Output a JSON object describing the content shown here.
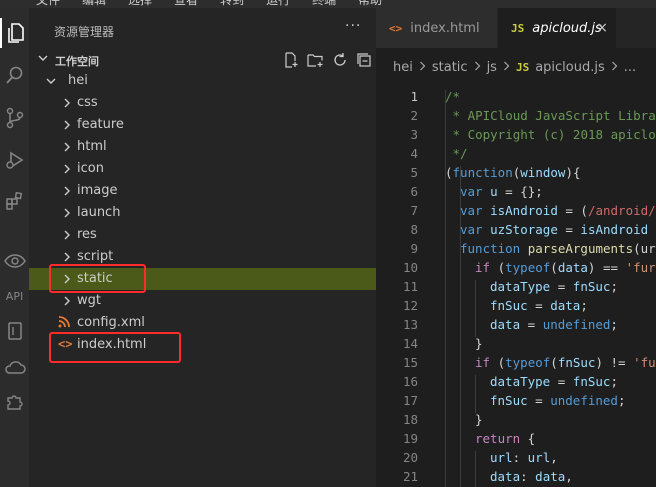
{
  "menu_bar": [
    "文件",
    "编辑",
    "选择",
    "查看",
    "转到",
    "运行",
    "终端",
    "帮助"
  ],
  "activity_bar": {
    "api_label": "API"
  },
  "explorer": {
    "title": "资源管理器",
    "more": "···",
    "workspace": "工作空间",
    "root": "hei",
    "folders": [
      "css",
      "feature",
      "html",
      "icon",
      "image",
      "launch",
      "res",
      "script",
      "static",
      "wgt"
    ],
    "selected_folder": "static",
    "files": [
      {
        "name": "config.xml",
        "icon": "rss-icon"
      },
      {
        "name": "index.html",
        "icon": "html-icon"
      }
    ]
  },
  "tabs": [
    {
      "label": "index.html",
      "icon": "<>",
      "active": false
    },
    {
      "label": "apicloud.js",
      "icon": "JS",
      "active": true,
      "close": "×"
    }
  ],
  "breadcrumb": {
    "parts": [
      "hei",
      "static",
      "js"
    ],
    "file_icon": "JS",
    "file": "apicloud.js",
    "tail": "..."
  },
  "code": {
    "current_line": 1,
    "lines": [
      {
        "n": "1",
        "indent": 0,
        "t": [
          [
            "/*",
            "cm"
          ]
        ]
      },
      {
        "n": "2",
        "indent": 0,
        "t": [
          [
            " * APICloud JavaScript Libra",
            "cm"
          ]
        ]
      },
      {
        "n": "3",
        "indent": 0,
        "t": [
          [
            " * Copyright (c) 2018 apiclo",
            "cm"
          ]
        ]
      },
      {
        "n": "4",
        "indent": 0,
        "t": [
          [
            " */",
            "cm"
          ]
        ]
      },
      {
        "n": "5",
        "indent": 0,
        "t": [
          [
            "(",
            "pu"
          ],
          [
            "function",
            "kw"
          ],
          [
            "(",
            "pu"
          ],
          [
            "window",
            "vr"
          ],
          [
            "){",
            "pu"
          ]
        ]
      },
      {
        "n": "6",
        "indent": 1,
        "t": [
          [
            "var",
            "kw"
          ],
          [
            " ",
            "pu"
          ],
          [
            "u",
            "vr"
          ],
          [
            " = {};",
            "pu"
          ]
        ]
      },
      {
        "n": "7",
        "indent": 1,
        "t": [
          [
            "var",
            "kw"
          ],
          [
            " ",
            "pu"
          ],
          [
            "isAndroid",
            "vr"
          ],
          [
            " = (",
            "pu"
          ],
          [
            "/android/",
            "rx"
          ]
        ]
      },
      {
        "n": "8",
        "indent": 1,
        "t": [
          [
            "var",
            "kw"
          ],
          [
            " ",
            "pu"
          ],
          [
            "uzStorage",
            "vr"
          ],
          [
            " = ",
            "pu"
          ],
          [
            "isAndroid",
            "vr"
          ]
        ]
      },
      {
        "n": "9",
        "indent": 1,
        "t": [
          [
            "function",
            "kw"
          ],
          [
            " ",
            "pu"
          ],
          [
            "parseArguments",
            "fn"
          ],
          [
            "(ur",
            "pu"
          ]
        ]
      },
      {
        "n": "10",
        "indent": 2,
        "t": [
          [
            "if",
            "ctl"
          ],
          [
            " (",
            "pu"
          ],
          [
            "typeof",
            "kw"
          ],
          [
            "(",
            "pu"
          ],
          [
            "data",
            "vr"
          ],
          [
            ") == ",
            "pu"
          ],
          [
            "'fur",
            "st"
          ]
        ]
      },
      {
        "n": "11",
        "indent": 3,
        "t": [
          [
            "dataType",
            "vr"
          ],
          [
            " = ",
            "pu"
          ],
          [
            "fnSuc",
            "vr"
          ],
          [
            ";",
            "pu"
          ]
        ]
      },
      {
        "n": "12",
        "indent": 3,
        "t": [
          [
            "fnSuc",
            "vr"
          ],
          [
            " = ",
            "pu"
          ],
          [
            "data",
            "vr"
          ],
          [
            ";",
            "pu"
          ]
        ]
      },
      {
        "n": "13",
        "indent": 3,
        "t": [
          [
            "data",
            "vr"
          ],
          [
            " = ",
            "pu"
          ],
          [
            "undefined",
            "kw"
          ],
          [
            ";",
            "pu"
          ]
        ]
      },
      {
        "n": "14",
        "indent": 2,
        "t": [
          [
            "}",
            "pu"
          ]
        ]
      },
      {
        "n": "15",
        "indent": 2,
        "t": [
          [
            "if",
            "ctl"
          ],
          [
            " (",
            "pu"
          ],
          [
            "typeof",
            "kw"
          ],
          [
            "(",
            "pu"
          ],
          [
            "fnSuc",
            "vr"
          ],
          [
            ") != ",
            "pu"
          ],
          [
            "'fu",
            "st"
          ]
        ]
      },
      {
        "n": "16",
        "indent": 3,
        "t": [
          [
            "dataType",
            "vr"
          ],
          [
            " = ",
            "pu"
          ],
          [
            "fnSuc",
            "vr"
          ],
          [
            ";",
            "pu"
          ]
        ]
      },
      {
        "n": "17",
        "indent": 3,
        "t": [
          [
            "fnSuc",
            "vr"
          ],
          [
            " = ",
            "pu"
          ],
          [
            "undefined",
            "kw"
          ],
          [
            ";",
            "pu"
          ]
        ]
      },
      {
        "n": "18",
        "indent": 2,
        "t": [
          [
            "}",
            "pu"
          ]
        ]
      },
      {
        "n": "19",
        "indent": 2,
        "t": [
          [
            "return",
            "ctl"
          ],
          [
            " {",
            "pu"
          ]
        ]
      },
      {
        "n": "20",
        "indent": 3,
        "t": [
          [
            "url",
            "vr"
          ],
          [
            ": ",
            "pu"
          ],
          [
            "url",
            "vr"
          ],
          [
            ",",
            "pu"
          ]
        ]
      },
      {
        "n": "21",
        "indent": 3,
        "t": [
          [
            "data",
            "vr"
          ],
          [
            ": ",
            "pu"
          ],
          [
            "data",
            "vr"
          ],
          [
            ",",
            "pu"
          ]
        ]
      }
    ]
  },
  "colors": {
    "selection": "#4b5a19",
    "highlight_box": "#ff2a2a",
    "js_icon": "#cbcb41",
    "html_icon": "#e37933"
  }
}
